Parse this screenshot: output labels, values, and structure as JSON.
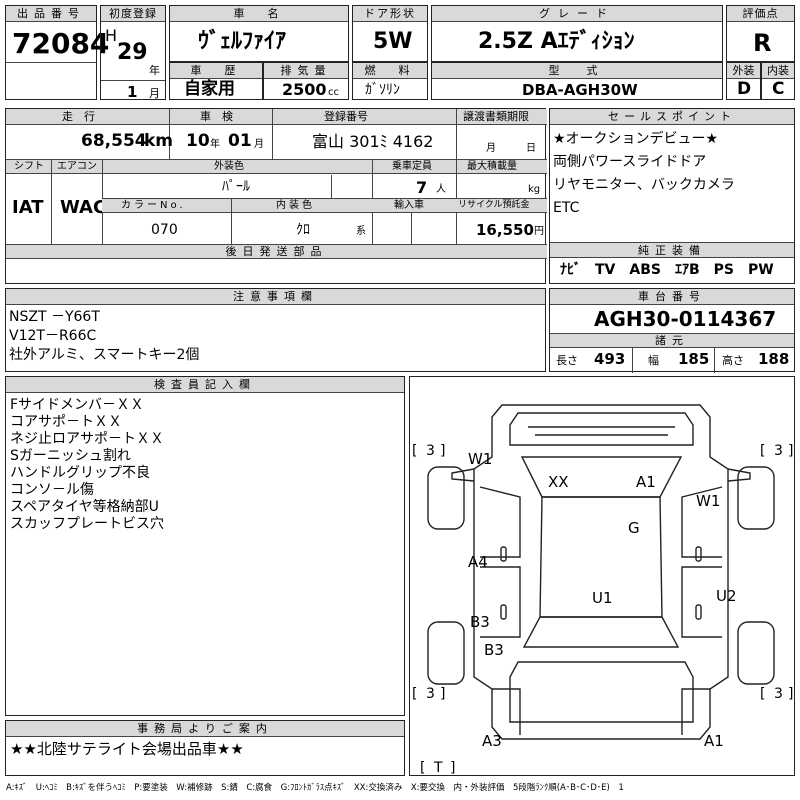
{
  "header": {
    "lot_label": "出品番号",
    "lot_number": "72084",
    "first_reg_label": "初度登録",
    "era_mark": "H",
    "first_reg_year": "29",
    "year_unit": "年",
    "first_reg_month": "1",
    "month_unit": "月",
    "model_label": "車　名",
    "model_name": "ｳﾞｪﾙﾌｧｲｱ",
    "door_label": "ドア形状",
    "door_value": "5W",
    "grade_label": "グレード",
    "grade_value": "2.5Z Aｴﾃﾞｨｼｮﾝ",
    "score_label": "評価点",
    "score_value": "R",
    "history_label": "車　歴",
    "history_value": "自家用",
    "displacement_label": "排気量",
    "displacement_value": "2500",
    "displacement_unit": "cc",
    "fuel_label": "燃　料",
    "fuel_value": "ｶﾞｿﾘﾝ",
    "type_label": "型　式",
    "type_value": "DBA-AGH30W",
    "ext_grade_label": "外装",
    "ext_grade_value": "D",
    "int_grade_label": "内装",
    "int_grade_value": "C"
  },
  "row2": {
    "mileage_label": "走　行",
    "mileage_value": "68,554",
    "mileage_unit": "km",
    "inspection_label": "車　検",
    "inspection_year": "10",
    "inspection_year_unit": "年",
    "inspection_month": "01",
    "inspection_month_unit": "月",
    "plate_label": "登録番号",
    "plate_value": "富山 301ﾐ 4162",
    "transfer_label": "譲渡書類期限",
    "transfer_month_unit": "月",
    "transfer_day_unit": "日",
    "shift_label": "シフト",
    "shift_value": "IAT",
    "ac_label": "エアコン",
    "ac_value": "WAC",
    "color_label": "外装色",
    "color_value": "ﾊﾟｰﾙ",
    "capacity_label": "乗車定員",
    "capacity_value": "7",
    "capacity_unit": "人",
    "load_label": "最大積載量",
    "load_unit": "kg",
    "color_no_label": "カラーNo.",
    "color_no_value": "070",
    "interior_color_label": "内装色",
    "interior_color_value": "ｸﾛ",
    "interior_color_unit": "系",
    "import_label": "輸入車",
    "recycle_label": "リサイクル預託金",
    "recycle_value": "16,550",
    "recycle_unit": "円",
    "later_parts_label": "後日発送部品"
  },
  "sales_point": {
    "label": "セールスポイント",
    "lines": [
      "★オークションデビュー★",
      "両側パワースライドドア",
      "リヤモニター、バックカメラ",
      "ETC"
    ]
  },
  "equipment": {
    "label": "純正装備",
    "value": "ﾅﾋﾞ　TV　ABS　ｴｱB　PS　PW"
  },
  "caution": {
    "label": "注意事項欄",
    "lines": [
      "NSZT －Y66T",
      "V12T－R66C",
      "社外アルミ、スマートキー2個"
    ]
  },
  "chassis": {
    "label": "車台番号",
    "value": "AGH30-0114367",
    "dims_label": "諸元",
    "length_label": "長さ",
    "length_value": "493",
    "width_label": "幅",
    "width_value": "185",
    "height_label": "高さ",
    "height_value": "188"
  },
  "inspector": {
    "label": "検査員記入欄",
    "lines": [
      "Fサイドメンバ－ＸＸ",
      "コアサポ－トＸＸ",
      "ネジ止ロアサポ－トＸＸ",
      "Sガーニッシュ割れ",
      "ハンドルグリップ不良",
      "コンソ－ル傷",
      "スペアタイヤ等格納部U",
      "スカッフプレートビス穴"
    ]
  },
  "office": {
    "label": "事務局よりご案内",
    "value": "★★北陸サテライト会場出品車★★"
  },
  "diagram": {
    "marks": {
      "w1_left": "W1",
      "w1_right": "W1",
      "xx": "XX",
      "a1_top": "A1",
      "g": "G",
      "a4": "A4",
      "u1": "U1",
      "u2": "U2",
      "b3_a": "B3",
      "b3_b": "B3",
      "a3": "A3",
      "a1_bottom": "A1"
    },
    "tires": {
      "front_left": "3",
      "front_right": "3",
      "rear_left": "3",
      "rear_right": "3",
      "spare": "T"
    }
  },
  "legend": "A:ｷｽﾞ　U:ﾍｺﾐ　B:ｷｽﾞを伴うﾍｺﾐ　P:要塗装　W:補修跡　S:錆　C:腐食　G:ﾌﾛﾝﾄｶﾞﾗｽ点ｷｽﾞ　XX:交換済み　X:要交換　内・外装評価　5段階ﾗﾝｸ順(A･B･C･D･E)　1"
}
